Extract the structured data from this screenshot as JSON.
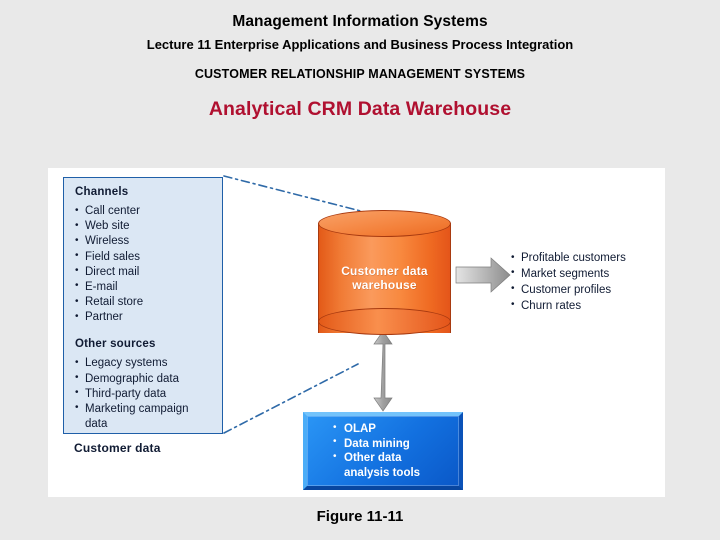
{
  "slide": {
    "course_title": "Management Information Systems",
    "lecture_title": "Lecture 11 Enterprise Applications and Business Process Integration",
    "section_title": "CUSTOMER RELATIONSHIP MANAGEMENT SYSTEMS",
    "figure_heading": "Analytical CRM Data Warehouse",
    "figure_caption": "Figure 11-11"
  },
  "colors": {
    "background": "#e9e9e9",
    "canvas": "#ffffff",
    "heading_red": "#b01030",
    "panel_fill": "#dbe7f4",
    "panel_border": "#1f5fa8",
    "cylinder_orange": "#f4823c",
    "analysis_blue": "#1371e0",
    "arrow_gray": "#9a9a9a",
    "connector_blue": "#2f6aa8"
  },
  "diagram": {
    "sources_panel": {
      "channels_heading": "Channels",
      "channels": [
        "Call center",
        "Web site",
        "Wireless",
        "Field sales",
        "Direct mail",
        "E-mail",
        "Retail store",
        "Partner"
      ],
      "other_sources_heading": "Other sources",
      "other_sources": [
        "Legacy systems",
        "Demographic data",
        "Third-party data",
        "Marketing campaign\ndata"
      ],
      "caption": "Customer data"
    },
    "warehouse": {
      "label": "Customer data\nwarehouse"
    },
    "outputs": [
      "Profitable customers",
      "Market segments",
      "Customer profiles",
      "Churn rates"
    ],
    "analysis_tools": [
      "OLAP",
      "Data mining",
      "Other data\nanalysis tools"
    ]
  }
}
